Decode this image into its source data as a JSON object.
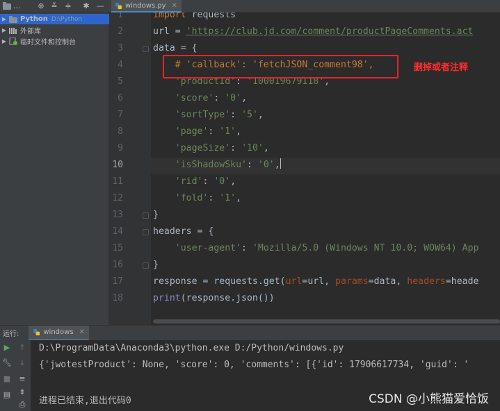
{
  "toolbar": {
    "project_label": "...",
    "collapse_icon": "minus-icon"
  },
  "editor_tab": {
    "filename": "windows.py"
  },
  "project_tree": [
    {
      "label": "Python",
      "path": "D:\\Python",
      "expanded": false
    },
    {
      "label": "外部库"
    },
    {
      "label": "临时文件和控制台"
    }
  ],
  "editor": {
    "current_line": 10,
    "line_numbers": [
      "1",
      "2",
      "3",
      "4",
      "5",
      "6",
      "7",
      "8",
      "9",
      "10",
      "11",
      "12",
      "13",
      "14",
      "15",
      "16",
      "17",
      "18"
    ],
    "lines": [
      {
        "parts": [
          [
            "kw",
            "import"
          ],
          [
            "",
            " requests"
          ]
        ]
      },
      {
        "parts": [
          [
            "",
            "url = "
          ],
          [
            "url",
            "'https://club.jd.com/comment/productPageComments.act"
          ]
        ]
      },
      {
        "parts": [
          [
            "",
            "data = {"
          ]
        ]
      },
      {
        "parts": [
          [
            "",
            "    "
          ],
          [
            "cmt",
            "# 'callback': 'fetchJSON_comment98',"
          ]
        ]
      },
      {
        "parts": [
          [
            "",
            "    "
          ],
          [
            "str",
            "'productId'"
          ],
          [
            "",
            ": "
          ],
          [
            "str",
            "'100019679118'"
          ],
          [
            "",
            ","
          ]
        ]
      },
      {
        "parts": [
          [
            "",
            "    "
          ],
          [
            "str",
            "'score'"
          ],
          [
            "",
            ": "
          ],
          [
            "str",
            "'0'"
          ],
          [
            "",
            ","
          ]
        ]
      },
      {
        "parts": [
          [
            "",
            "    "
          ],
          [
            "str",
            "'sortType'"
          ],
          [
            "",
            ": "
          ],
          [
            "str",
            "'5'"
          ],
          [
            "",
            ","
          ]
        ]
      },
      {
        "parts": [
          [
            "",
            "    "
          ],
          [
            "str",
            "'page'"
          ],
          [
            "",
            ": "
          ],
          [
            "str",
            "'1'"
          ],
          [
            "",
            ","
          ]
        ]
      },
      {
        "parts": [
          [
            "",
            "    "
          ],
          [
            "str",
            "'pageSize'"
          ],
          [
            "",
            ": "
          ],
          [
            "str",
            "'10'"
          ],
          [
            "",
            ","
          ]
        ]
      },
      {
        "parts": [
          [
            "",
            "    "
          ],
          [
            "str",
            "'isShadowSku'"
          ],
          [
            "",
            ": "
          ],
          [
            "str",
            "'0'"
          ],
          [
            "",
            ","
          ]
        ]
      },
      {
        "parts": [
          [
            "",
            "    "
          ],
          [
            "str",
            "'rid'"
          ],
          [
            "",
            ": "
          ],
          [
            "str",
            "'0'"
          ],
          [
            "",
            ","
          ]
        ]
      },
      {
        "parts": [
          [
            "",
            "    "
          ],
          [
            "str",
            "'fold'"
          ],
          [
            "",
            ": "
          ],
          [
            "str",
            "'1'"
          ],
          [
            "",
            ","
          ]
        ]
      },
      {
        "parts": [
          [
            "",
            "}"
          ]
        ]
      },
      {
        "parts": [
          [
            "",
            "headers = {"
          ]
        ]
      },
      {
        "parts": [
          [
            "",
            "    "
          ],
          [
            "str",
            "'user-agent'"
          ],
          [
            "",
            ": "
          ],
          [
            "str",
            "'Mozilla/5.0 (Windows NT 10.0; WOW64) App"
          ]
        ]
      },
      {
        "parts": [
          [
            "",
            "}"
          ]
        ]
      },
      {
        "parts": [
          [
            "",
            "response = requests.get("
          ],
          [
            "prm",
            "url"
          ],
          [
            "",
            "=url, "
          ],
          [
            "prm",
            "params"
          ],
          [
            "",
            "=data, "
          ],
          [
            "prm",
            "headers"
          ],
          [
            "",
            "=heade"
          ]
        ]
      },
      {
        "parts": [
          [
            "bi",
            "print"
          ],
          [
            "",
            "(response.json())"
          ]
        ]
      }
    ],
    "annotation": "删掉或者注释"
  },
  "run_panel": {
    "label": "运行:",
    "tab_name": "windows",
    "output": [
      "D:\\ProgramData\\Anaconda3\\python.exe D:/Python/windows.py",
      "{'jwotestProduct': None, 'score': 0, 'comments': [{'id': 17906617734, 'guid': '",
      "进程已结束,退出代码0"
    ]
  },
  "watermark": "CSDN @小熊猫爱恰饭",
  "colors": {
    "background": "#2b2b2b",
    "keyword": "#cc7832",
    "string": "#6a8759",
    "annotation_red": "#e8232a"
  }
}
